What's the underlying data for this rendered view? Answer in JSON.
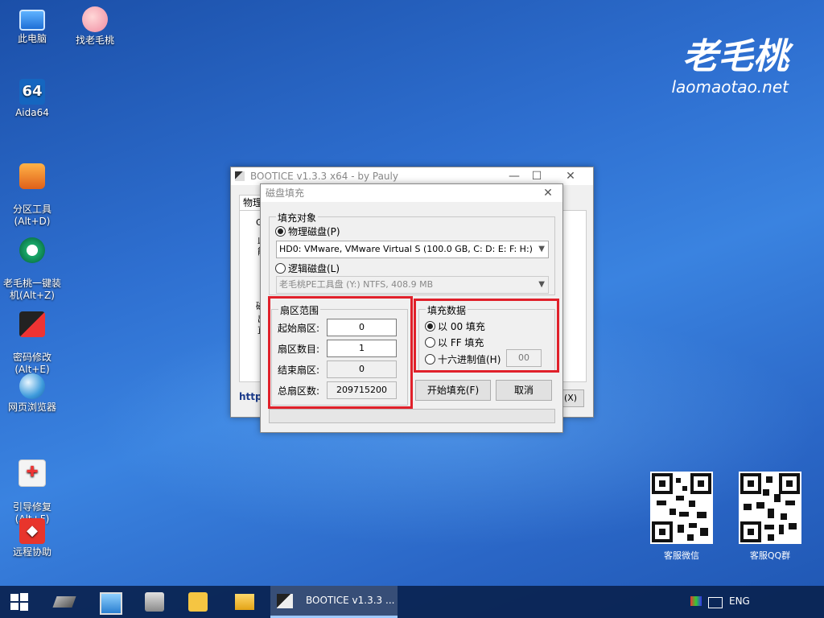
{
  "desktop": {
    "icons": [
      {
        "label": "此电脑",
        "icon": "computer-icon"
      },
      {
        "label": "找老毛桃",
        "icon": "peach-icon"
      },
      {
        "label": "Aida64",
        "icon": "aida64-icon",
        "glyph": "64"
      },
      {
        "label": "分区工具\n(Alt+D)",
        "icon": "partition-tool-icon"
      },
      {
        "label": "老毛桃一键装\n机(Alt+Z)",
        "icon": "one-key-install-icon"
      },
      {
        "label": "密码修改\n(Alt+E)",
        "icon": "password-tool-icon"
      },
      {
        "label": "网页浏览器",
        "icon": "web-browser-icon"
      },
      {
        "label": "引导修复\n(Alt+F)",
        "icon": "boot-repair-icon"
      },
      {
        "label": "远程协助",
        "icon": "remote-assist-icon"
      }
    ],
    "brand": {
      "name": "老毛桃",
      "url": "laomaotao.net"
    },
    "qr_codes": [
      {
        "label": "客服微信"
      },
      {
        "label": "客服QQ群"
      }
    ]
  },
  "bootice": {
    "title": "BOOTICE v1.3.3 x64 - by Pauly",
    "tab_partial": "物理",
    "fragments": {
      "g": "G",
      "a": "此",
      "b": "能",
      "c": "磁",
      "d": "出",
      "e": "直"
    },
    "url_partial": "https",
    "close_partial": "(X)"
  },
  "dialog": {
    "title": "磁盘填充",
    "fill_target": {
      "legend": "填充对象",
      "physical_label": "物理磁盘(P)",
      "physical_selected": true,
      "physical_value": "HD0: VMware, VMware Virtual S (100.0 GB, C: D: E: F: H:)",
      "logical_label": "逻辑磁盘(L)",
      "logical_selected": false,
      "logical_value": "老毛桃PE工具盘 (Y:)  NTFS, 408.9 MB"
    },
    "sector_range": {
      "legend": "扇区范围",
      "start_label": "起始扇区:",
      "start_value": "0",
      "count_label": "扇区数目:",
      "count_value": "1",
      "end_label": "结束扇区:",
      "end_value": "0",
      "total_label": "总扇区数:",
      "total_value": "209715200"
    },
    "fill_data": {
      "legend": "填充数据",
      "opt_00": "以 00 填充",
      "opt_ff": "以 FF 填充",
      "opt_hex": "十六进制值(H)",
      "hex_value": "00",
      "selected": "00"
    },
    "start_button": "开始填充(F)",
    "cancel_button": "取消"
  },
  "taskbar": {
    "active_window": "BOOTICE v1.3.3 ...",
    "lang": "ENG"
  },
  "colors": {
    "highlight": "#e0202a",
    "taskbar": "#0a2350"
  }
}
